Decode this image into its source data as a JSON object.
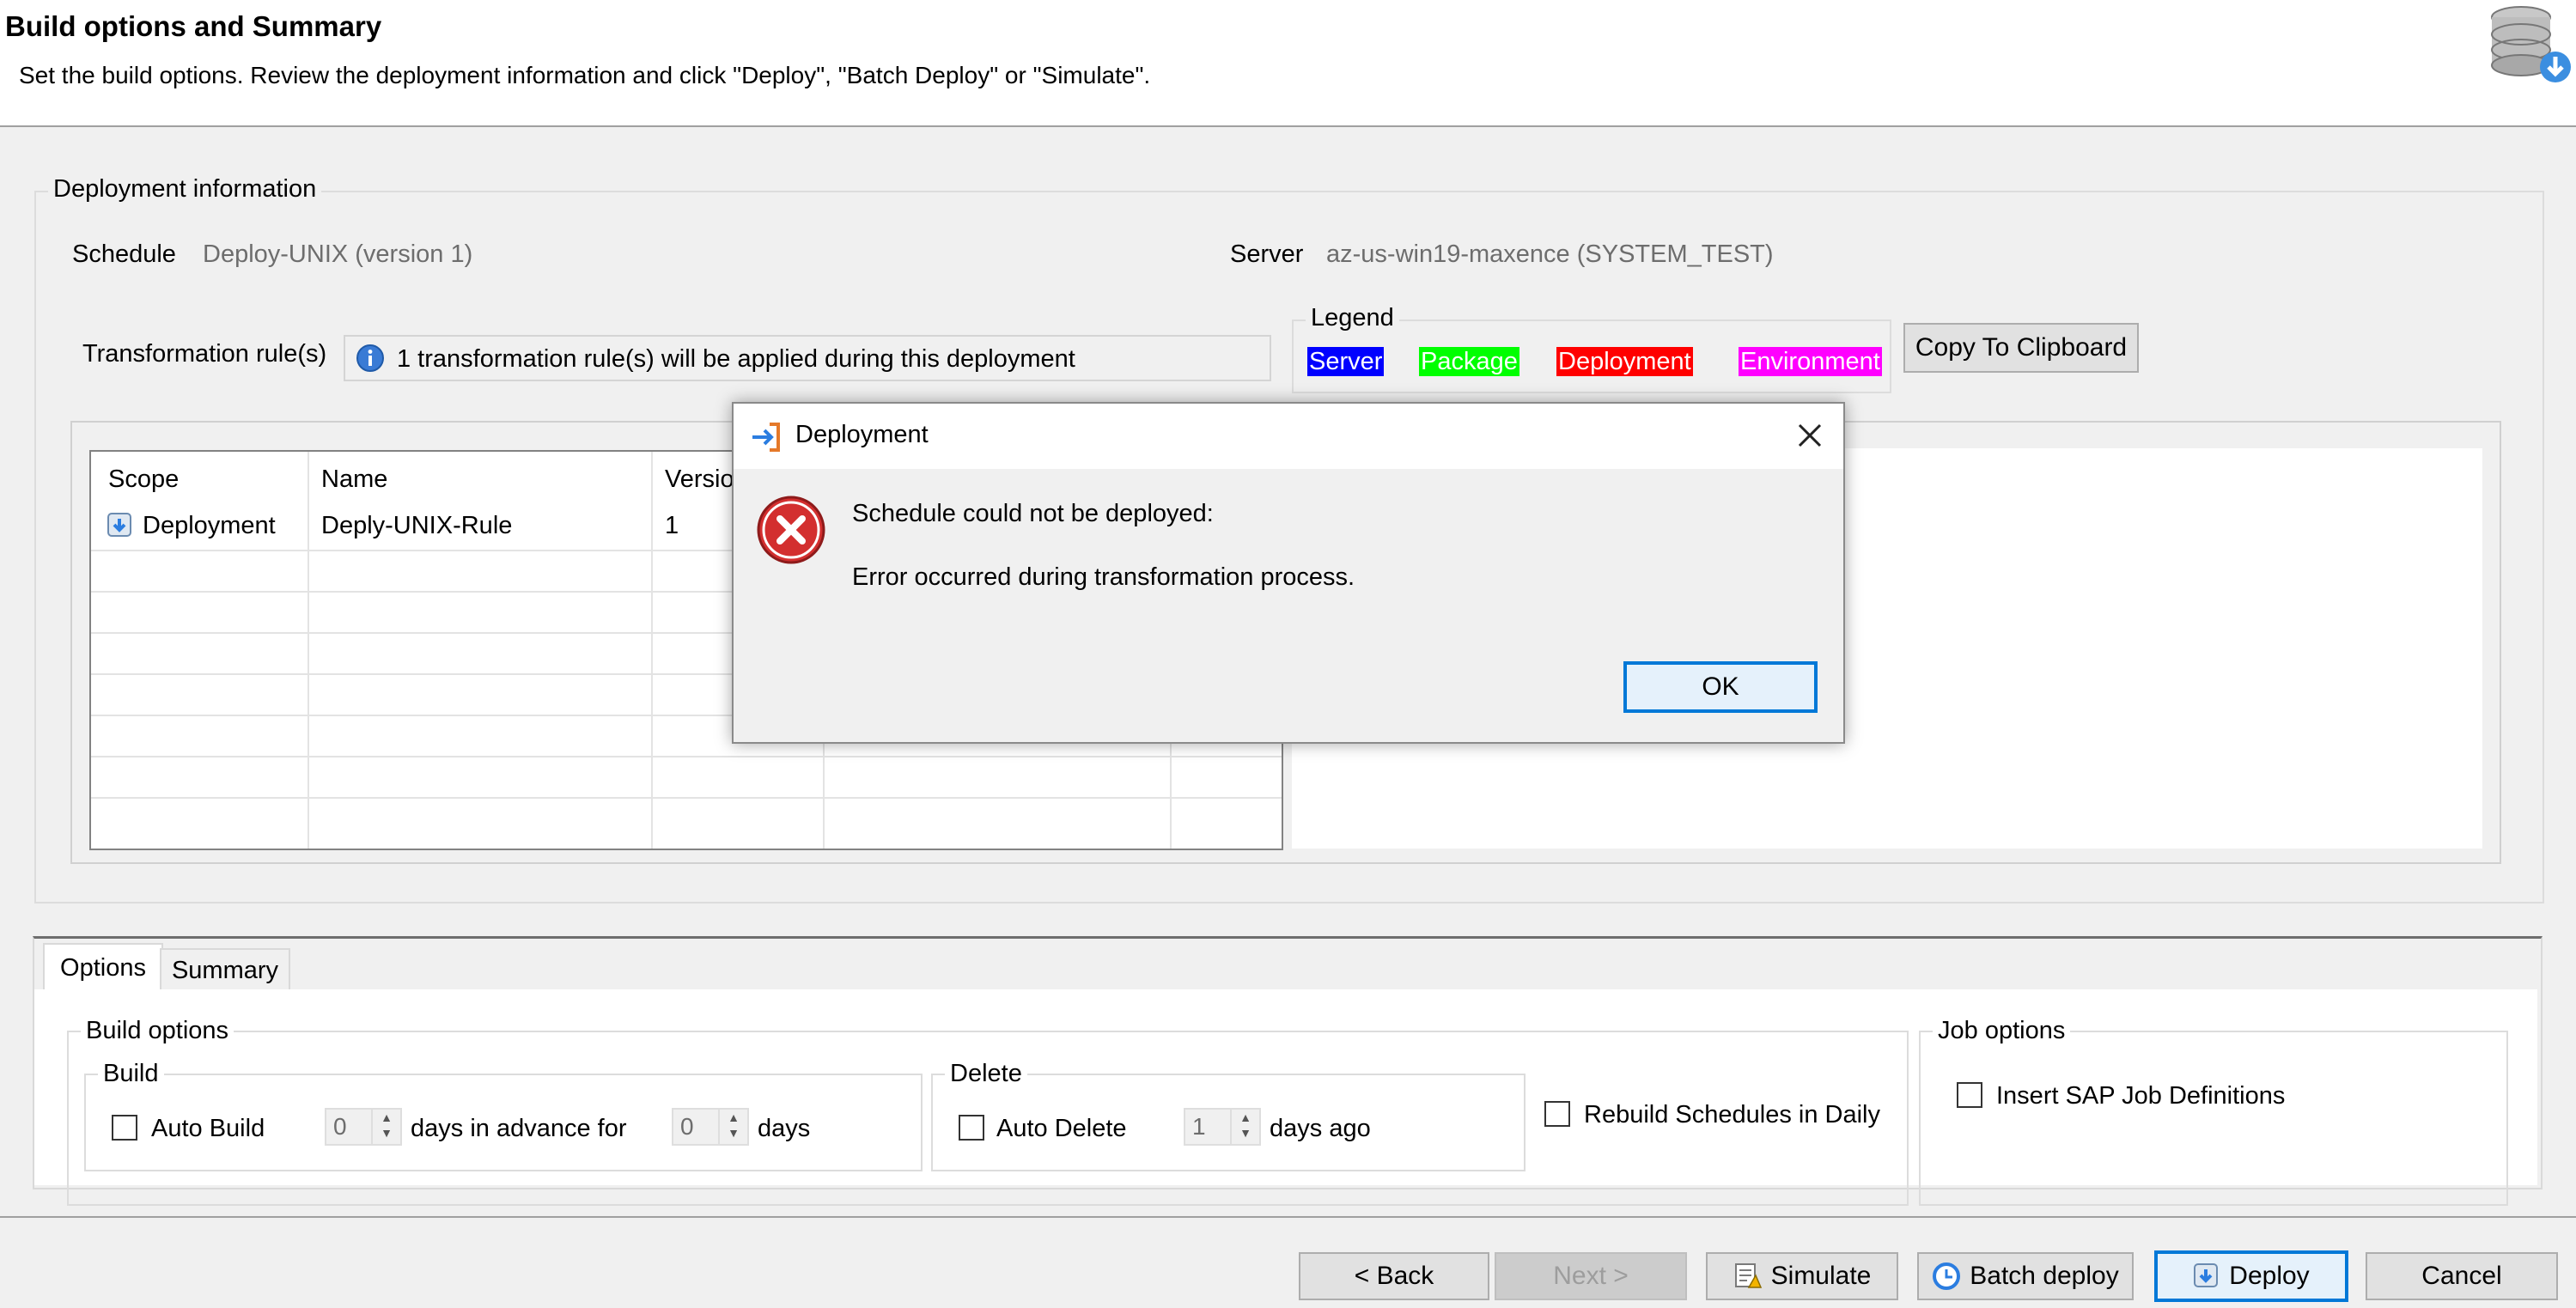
{
  "header": {
    "title": "Build options and Summary",
    "subtitle": "Set the build options. Review the deployment information and click \"Deploy\", \"Batch Deploy\" or \"Simulate\".",
    "icon": "database-deploy-icon"
  },
  "deployment_info": {
    "group_label": "Deployment information",
    "schedule_label": "Schedule",
    "schedule_value": "Deploy-UNIX (version 1)",
    "server_label": "Server",
    "server_value": "az-us-win19-maxence (SYSTEM_TEST)",
    "transformation_label": "Transformation rule(s)",
    "transformation_value": "1 transformation rule(s) will be applied during this deployment",
    "legend": {
      "label": "Legend",
      "items": [
        {
          "label": "Server",
          "bg": "#0000ff",
          "fg": "#ffffff"
        },
        {
          "label": "Package",
          "bg": "#00ff00",
          "fg": "#ffffff"
        },
        {
          "label": "Deployment",
          "bg": "#ff0000",
          "fg": "#ffffff"
        },
        {
          "label": "Environment",
          "bg": "#ff00ff",
          "fg": "#ffffff"
        }
      ]
    },
    "copy_button": "Copy To Clipboard",
    "table": {
      "columns": [
        "Scope",
        "Name",
        "Versio"
      ],
      "rows": [
        {
          "scope": "Deployment",
          "name": "Deply-UNIX-Rule",
          "version": "1"
        }
      ]
    }
  },
  "dialog": {
    "title": "Deployment",
    "message1": "Schedule could not be deployed:",
    "message2": "Error occurred during transformation process.",
    "ok": "OK",
    "close_icon": "close-icon"
  },
  "tabs": [
    "Options",
    "Summary"
  ],
  "options": {
    "build_options_label": "Build options",
    "build_label": "Build",
    "auto_build": "Auto Build",
    "advance_days": "0",
    "days_in_advance_for": "days in advance for",
    "for_days": "0",
    "days": "days",
    "delete_label": "Delete",
    "auto_delete": "Auto Delete",
    "delete_days": "1",
    "days_ago": "days ago",
    "rebuild": "Rebuild Schedules in Daily",
    "job_options_label": "Job options",
    "insert_sap": "Insert SAP Job Definitions"
  },
  "footer": {
    "back": "< Back",
    "next": "Next >",
    "simulate": "Simulate",
    "batch_deploy": "Batch deploy",
    "deploy": "Deploy",
    "cancel": "Cancel"
  },
  "colors": {
    "accent": "#0078d7",
    "error": "#d32f2f"
  }
}
